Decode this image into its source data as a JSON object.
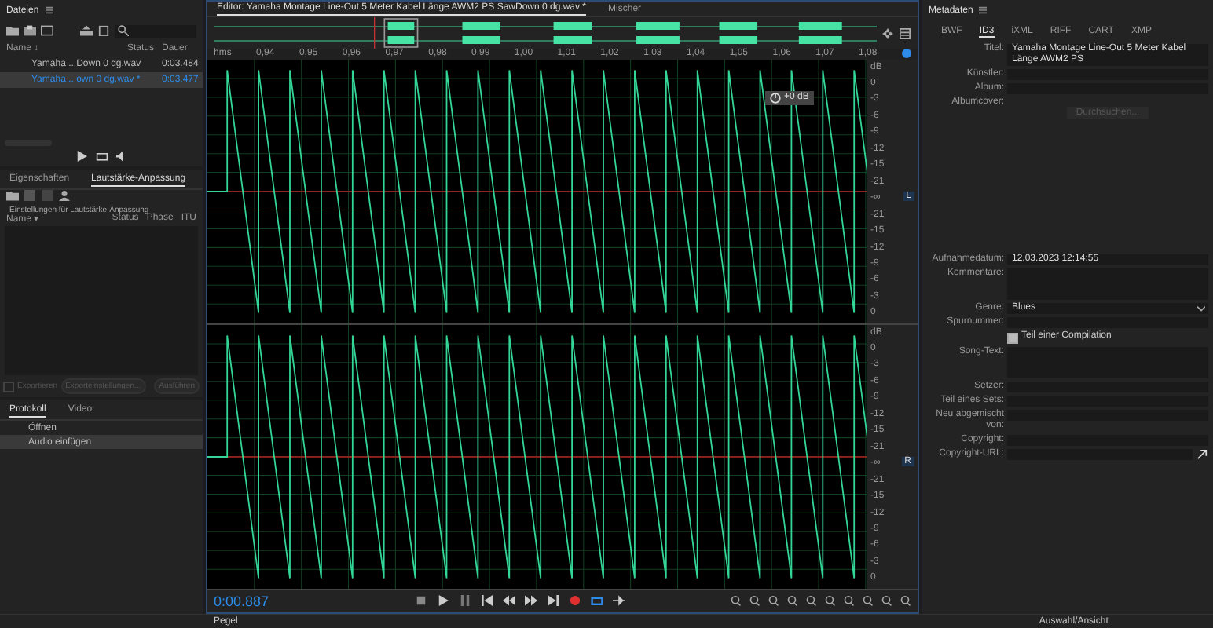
{
  "files_panel": {
    "title": "Dateien",
    "columns": [
      "Name ↓",
      "Status",
      "Dauer"
    ],
    "rows": [
      {
        "name": "Yamaha ...Down 0 dg.wav",
        "duration": "0:03.484",
        "selected": false
      },
      {
        "name": "Yamaha ...own 0 dg.wav *",
        "duration": "0:03.477",
        "selected": true
      }
    ]
  },
  "loudness_panel": {
    "tabs": [
      {
        "label": "Eigenschaften",
        "selected": false
      },
      {
        "label": "Lautstärke-Anpassung",
        "selected": true
      }
    ],
    "settings_label": "Einstellungen für Lautstärke-Anpassung",
    "columns": [
      "Name ▾",
      "Status",
      "Phase",
      "ITU"
    ],
    "export_checkbox": {
      "label": "Exportieren",
      "checked": false,
      "disabled": true
    },
    "buttons": [
      {
        "label": "Exporteinstellungen...",
        "disabled": true
      },
      {
        "label": "Ausführen",
        "disabled": true
      }
    ]
  },
  "history_panel": {
    "tabs": [
      {
        "label": "Protokoll",
        "selected": true
      },
      {
        "label": "Video",
        "selected": false
      }
    ],
    "items": [
      {
        "label": "Öffnen",
        "selected": false
      },
      {
        "label": "Audio einfügen",
        "selected": true
      }
    ]
  },
  "editor": {
    "tabs": [
      {
        "label": "Editor: Yamaha Montage Line-Out 5 Meter Kabel Länge AWM2 PS SawDown 0 dg.wav *",
        "selected": true
      },
      {
        "label": "Mischer",
        "selected": false
      }
    ],
    "ruler_unit": "hms",
    "ruler_labels": [
      "0,94",
      "0,95",
      "0,96",
      "0,97",
      "0,98",
      "0,99",
      "1,00",
      "1,01",
      "1,02",
      "1,03",
      "1,04",
      "1,05",
      "1,06",
      "1,07",
      "1,08"
    ],
    "hud_gain": "+0 dB",
    "channels": [
      {
        "label": "L",
        "scale": [
          "dB",
          "0",
          "-3",
          "-6",
          "-9",
          "-12",
          "-15",
          "-21",
          "-∞",
          "-21",
          "-15",
          "-12",
          "-9",
          "-6",
          "-3",
          "0"
        ]
      },
      {
        "label": "R",
        "scale": [
          "dB",
          "0",
          "-3",
          "-6",
          "-9",
          "-12",
          "-15",
          "-21",
          "-∞",
          "-21",
          "-15",
          "-12",
          "-9",
          "-6",
          "-3",
          "0"
        ]
      }
    ],
    "time": "0:00.887"
  },
  "metadata_panel": {
    "title": "Metadaten",
    "tabs": [
      {
        "label": "BWF",
        "selected": false
      },
      {
        "label": "ID3",
        "selected": true
      },
      {
        "label": "iXML",
        "selected": false
      },
      {
        "label": "RIFF",
        "selected": false
      },
      {
        "label": "CART",
        "selected": false
      },
      {
        "label": "XMP",
        "selected": false
      }
    ],
    "fields": [
      {
        "kind": "text",
        "label": "Titel:",
        "value": "Yamaha Montage Line-Out 5 Meter Kabel Länge AWM2 PS"
      },
      {
        "kind": "text",
        "label": "Künstler:"
      },
      {
        "kind": "text",
        "label": "Album:"
      },
      {
        "kind": "cover",
        "label": "Albumcover:",
        "button": "Durchsuchen..."
      },
      {
        "kind": "text",
        "label": "Aufnahmedatum:",
        "value": "12.03.2023 12:14:55"
      },
      {
        "kind": "area",
        "label": "Kommentare:"
      },
      {
        "kind": "select",
        "label": "Genre:",
        "value": "Blues"
      },
      {
        "kind": "text",
        "label": "Spurnummer:"
      },
      {
        "kind": "check",
        "label": "Teil einer Compilation",
        "checked": true
      },
      {
        "kind": "area",
        "label": "Song-Text:"
      },
      {
        "kind": "text",
        "label": "Setzer:"
      },
      {
        "kind": "text",
        "label": "Teil eines Sets:"
      },
      {
        "kind": "text",
        "label": "Neu abgemischt von:"
      },
      {
        "kind": "text",
        "label": "Copyright:"
      },
      {
        "kind": "url",
        "label": "Copyright-URL:"
      }
    ]
  },
  "bottom_panels": [
    "Pegel",
    "Auswahl/Ansicht"
  ]
}
